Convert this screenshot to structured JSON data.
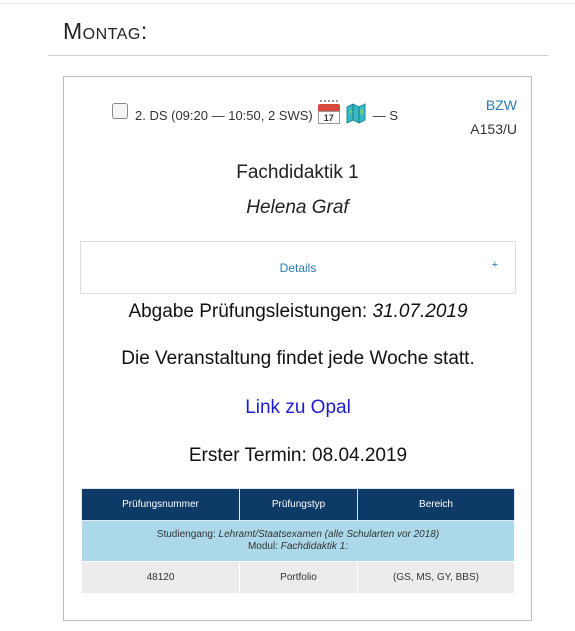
{
  "day": {
    "label": "Montag:"
  },
  "slot": {
    "text": "2. DS (09:20 — 10:50, 2 SWS)",
    "calendar_icon_day": "17",
    "suffix": "— S",
    "icons": [
      "checkbox",
      "calendar-icon",
      "map-icon"
    ]
  },
  "room": {
    "building": "BZW",
    "number": "A153/U"
  },
  "course": {
    "title": "Fachdidaktik 1",
    "lecturer": "Helena Graf"
  },
  "details": {
    "label": "Details",
    "toggle": "+"
  },
  "deadline": {
    "label": "Abgabe Prüfungsleistungen: ",
    "date": "31.07.2019"
  },
  "frequency": {
    "text": "Die Veranstaltung findet jede Woche statt."
  },
  "link": {
    "label": "Link zu Opal"
  },
  "first_date": {
    "text": "Erster Termin: 08.04.2019"
  },
  "exam_table": {
    "headers": [
      "Prüfungsnummer",
      "Prüfungstyp",
      "Bereich"
    ],
    "info": {
      "studiengang_label": "Studiengang: ",
      "studiengang_value": "Lehramt/Staatsexamen (alle Schularten vor 2018)",
      "modul_label": "Modul: ",
      "modul_value": "Fachdidaktik 1:"
    },
    "rows": [
      [
        "48120",
        "Portfolio",
        "(GS, MS, GY, BBS)"
      ]
    ]
  },
  "colors": {
    "header_bg": "#0e3a68",
    "info_bg": "#abd9e9",
    "row_bg": "#ececec",
    "link": "#2a7ab0",
    "opal_link": "#1c1ccc"
  }
}
